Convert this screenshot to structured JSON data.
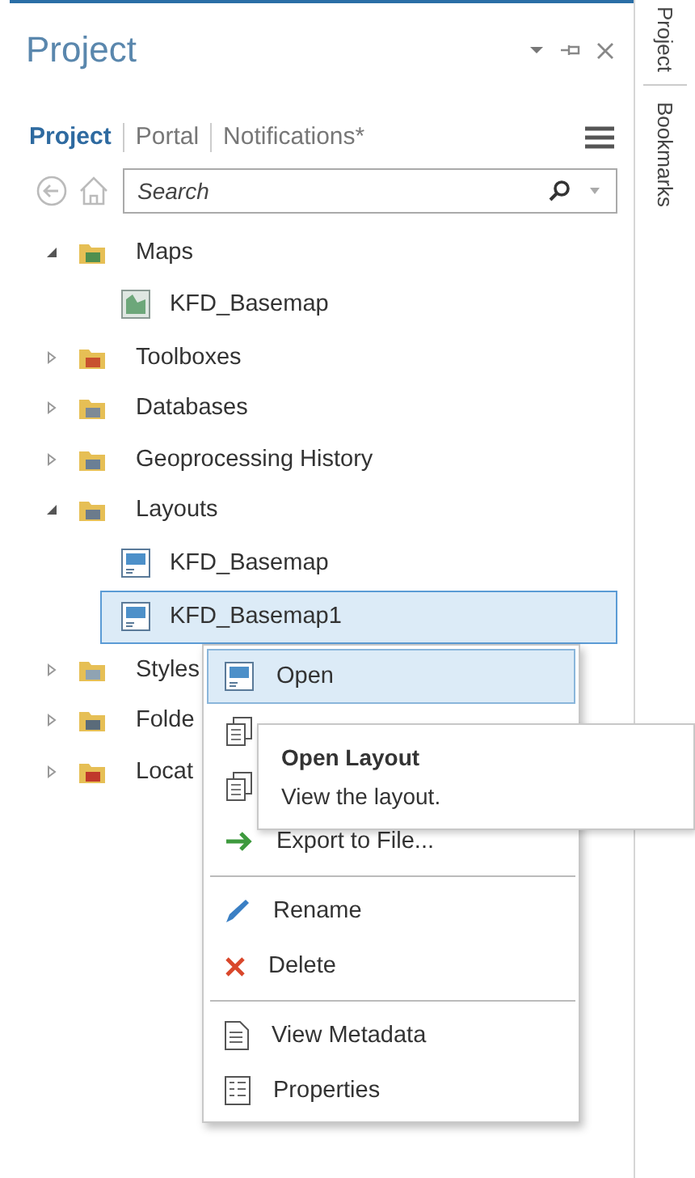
{
  "panel": {
    "title": "Project"
  },
  "tabs": [
    {
      "label": "Project",
      "selected": true
    },
    {
      "label": "Portal",
      "selected": false
    },
    {
      "label": "Notifications*",
      "selected": false
    }
  ],
  "search": {
    "placeholder": "Search"
  },
  "tree": [
    {
      "label": "Maps",
      "kind": "maps",
      "expanded": true,
      "children": [
        {
          "label": "KFD_Basemap",
          "kind": "map",
          "selected": false
        }
      ]
    },
    {
      "label": "Toolboxes",
      "kind": "toolboxes",
      "expanded": false
    },
    {
      "label": "Databases",
      "kind": "databases",
      "expanded": false
    },
    {
      "label": "Geoprocessing History",
      "kind": "history",
      "expanded": false
    },
    {
      "label": "Layouts",
      "kind": "layouts",
      "expanded": true,
      "children": [
        {
          "label": "KFD_Basemap",
          "kind": "layout",
          "selected": false
        },
        {
          "label": "KFD_Basemap1",
          "kind": "layout",
          "selected": true
        }
      ]
    },
    {
      "label": "Styles",
      "kind": "styles",
      "expanded": false
    },
    {
      "label": "Folde",
      "kind": "folders",
      "expanded": false
    },
    {
      "label": "Locat",
      "kind": "locators",
      "expanded": false
    }
  ],
  "context_menu": {
    "items": [
      {
        "kind": "layout",
        "label": "Open",
        "selected": true
      },
      {
        "kind": "save"
      },
      {
        "kind": "copy"
      },
      {
        "kind": "export",
        "label": "Export to File...",
        "selected": false
      },
      {
        "kind": "separator"
      },
      {
        "kind": "rename",
        "label": "Rename",
        "selected": false
      },
      {
        "kind": "delete",
        "label": "Delete",
        "selected": false
      },
      {
        "kind": "separator"
      },
      {
        "kind": "metadata",
        "label": "View Metadata",
        "selected": false
      },
      {
        "kind": "properties",
        "label": "Properties",
        "selected": false
      }
    ]
  },
  "tooltip": {
    "title": "Open Layout",
    "text": "View the layout."
  },
  "side_tabs": [
    {
      "label": "Project"
    },
    {
      "label": "Bookmarks"
    }
  ]
}
